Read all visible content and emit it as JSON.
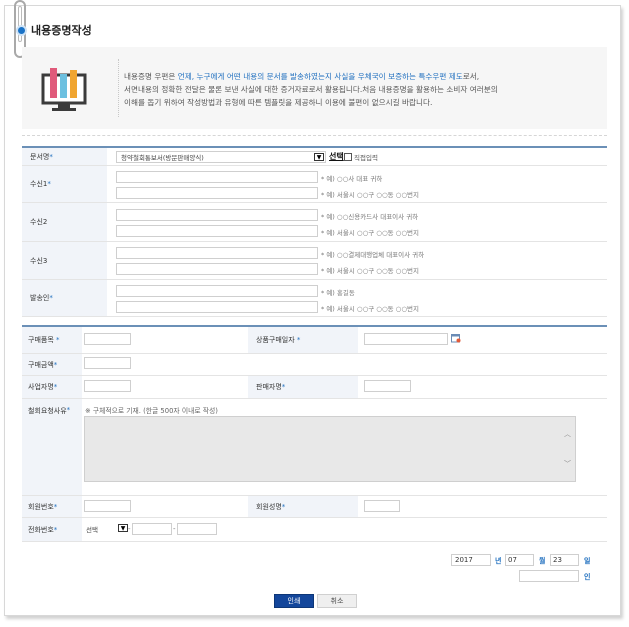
{
  "page": {
    "title": "내용증명작성",
    "intro": {
      "line1_a": "내용증명 우편은 ",
      "line1_b": "언제, 누구에게 어떤 내용의 문서를 발송하였는지 사실을 우체국이 보증하는 특수우편 제도",
      "line1_c": "로서,",
      "line2": "서면내용의 정확한 전달은 물론 보낸 사실에 대한 증거자료로서 활용됩니다.처음 내용증명을 활용하는 소비자 여러분의",
      "line3": "이해를 돕기 위하여 작성방법과 유형에 따른 템플릿을 제공하니 이용에 불편이 없으시길 바랍니다."
    }
  },
  "form1": {
    "doc_type": {
      "label": "문서명",
      "selected": "청약철회통보서(방문판매양식)",
      "select_button": "선택",
      "direct_input_label": "직접입력"
    },
    "recipient1": {
      "label": "수신1",
      "hint_name": "* 예) ○○사 대표 귀하",
      "hint_addr": "* 예) 서울시 ○○구 ○○동 ○○번지"
    },
    "recipient2": {
      "label": "수신2",
      "hint_name": "* 예) ○○신용카드사 대표이사 귀하",
      "hint_addr": "* 예) 서울시 ○○구 ○○동 ○○번지"
    },
    "recipient3": {
      "label": "수신3",
      "hint_name": "* 예) ○○결제대행업체 대표이사 귀하",
      "hint_addr": "* 예) 서울시 ○○구 ○○동 ○○번지"
    },
    "sender": {
      "label": "발송인",
      "hint_name": "* 예) 홍길동",
      "hint_addr": "* 예) 서울시 ○○구 ○○동 ○○번지"
    }
  },
  "form2": {
    "purchase_item": "구매품목",
    "purchase_date": "상품구매일자",
    "purchase_amount": "구매금액",
    "business_name": "사업자명",
    "seller_name": "판매자명",
    "reason_label": "철회요청사유",
    "reason_hint": "※ 구체적으로 기재. (한글 500자 이내로 작성)",
    "member_no": "회원번호",
    "member_name": "회원성명",
    "phone_label": "전화번호",
    "phone_select": "선택",
    "phone_dash": "-"
  },
  "signature": {
    "year": "2017",
    "year_unit": "년",
    "month": "07",
    "month_unit": "월",
    "day": "23",
    "day_unit": "일",
    "seal_unit": "인"
  },
  "buttons": {
    "print": "인쇄",
    "cancel": "취소"
  },
  "icons": {
    "title_bullet": "circle-bullet-icon",
    "calendar": "calendar-icon",
    "document_chart": "document-chart-icon",
    "paperclip": "paperclip-icon"
  },
  "colors": {
    "accent": "#1f6fbf",
    "section_line": "#6b90b7",
    "primary_button": "#13469b"
  }
}
